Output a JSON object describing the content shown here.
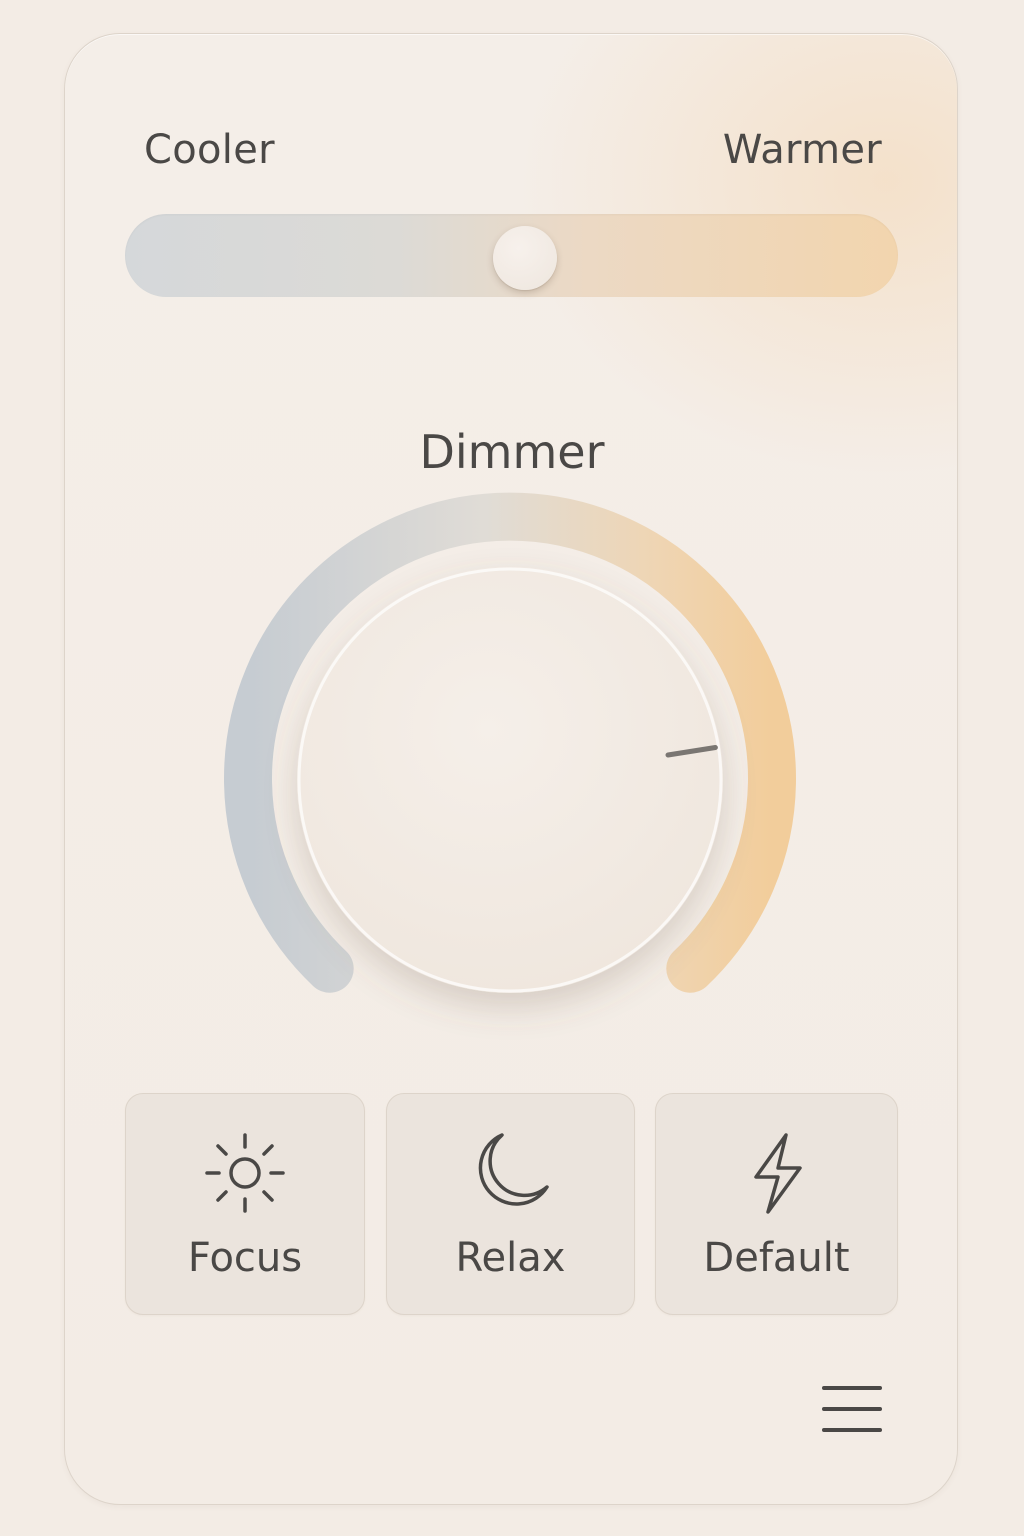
{
  "temperature": {
    "cooler_label": "Cooler",
    "warmer_label": "Warmer",
    "value": 0.52
  },
  "dimmer": {
    "title": "Dimmer",
    "level": 0.8
  },
  "presets": [
    {
      "label": "Focus",
      "icon": "sun-icon"
    },
    {
      "label": "Relax",
      "icon": "moon-icon"
    },
    {
      "label": "Default",
      "icon": "lightning-bolt-icon"
    }
  ],
  "menu": {
    "icon": "hamburger-menu-icon"
  },
  "colors": {
    "background": "#f3ece5",
    "cool": "#c9d0d6",
    "warm": "#f2cf9f",
    "text": "#4a4846"
  }
}
